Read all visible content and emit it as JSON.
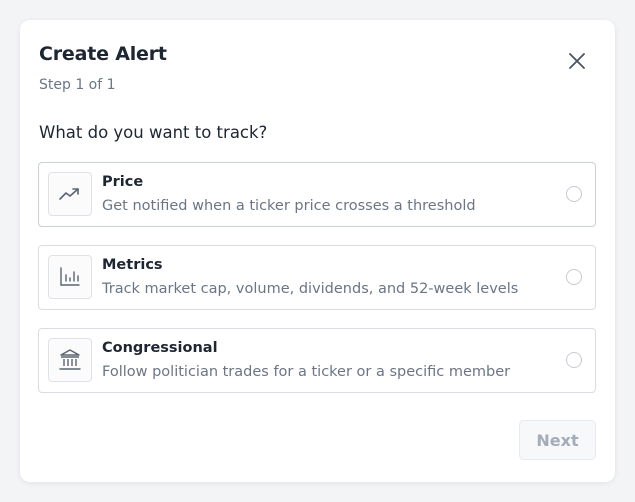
{
  "dialog": {
    "title": "Create Alert",
    "step": "Step 1 of 1",
    "question": "What do you want to track?",
    "close_icon": "close-icon",
    "options": [
      {
        "icon": "trending-up-icon",
        "title": "Price",
        "description": "Get notified when a ticker price crosses a threshold",
        "selected": false
      },
      {
        "icon": "bar-chart-icon",
        "title": "Metrics",
        "description": "Track market cap, volume, dividends, and 52-week levels",
        "selected": false
      },
      {
        "icon": "bank-building-icon",
        "title": "Congressional",
        "description": "Follow politician trades for a ticker or a specific member",
        "selected": false
      }
    ],
    "next_label": "Next",
    "next_disabled": true
  },
  "colors": {
    "text_primary": "#1e2633",
    "text_secondary": "#6b7585",
    "border": "#d9dde3",
    "disabled_text": "#a3acb8"
  }
}
